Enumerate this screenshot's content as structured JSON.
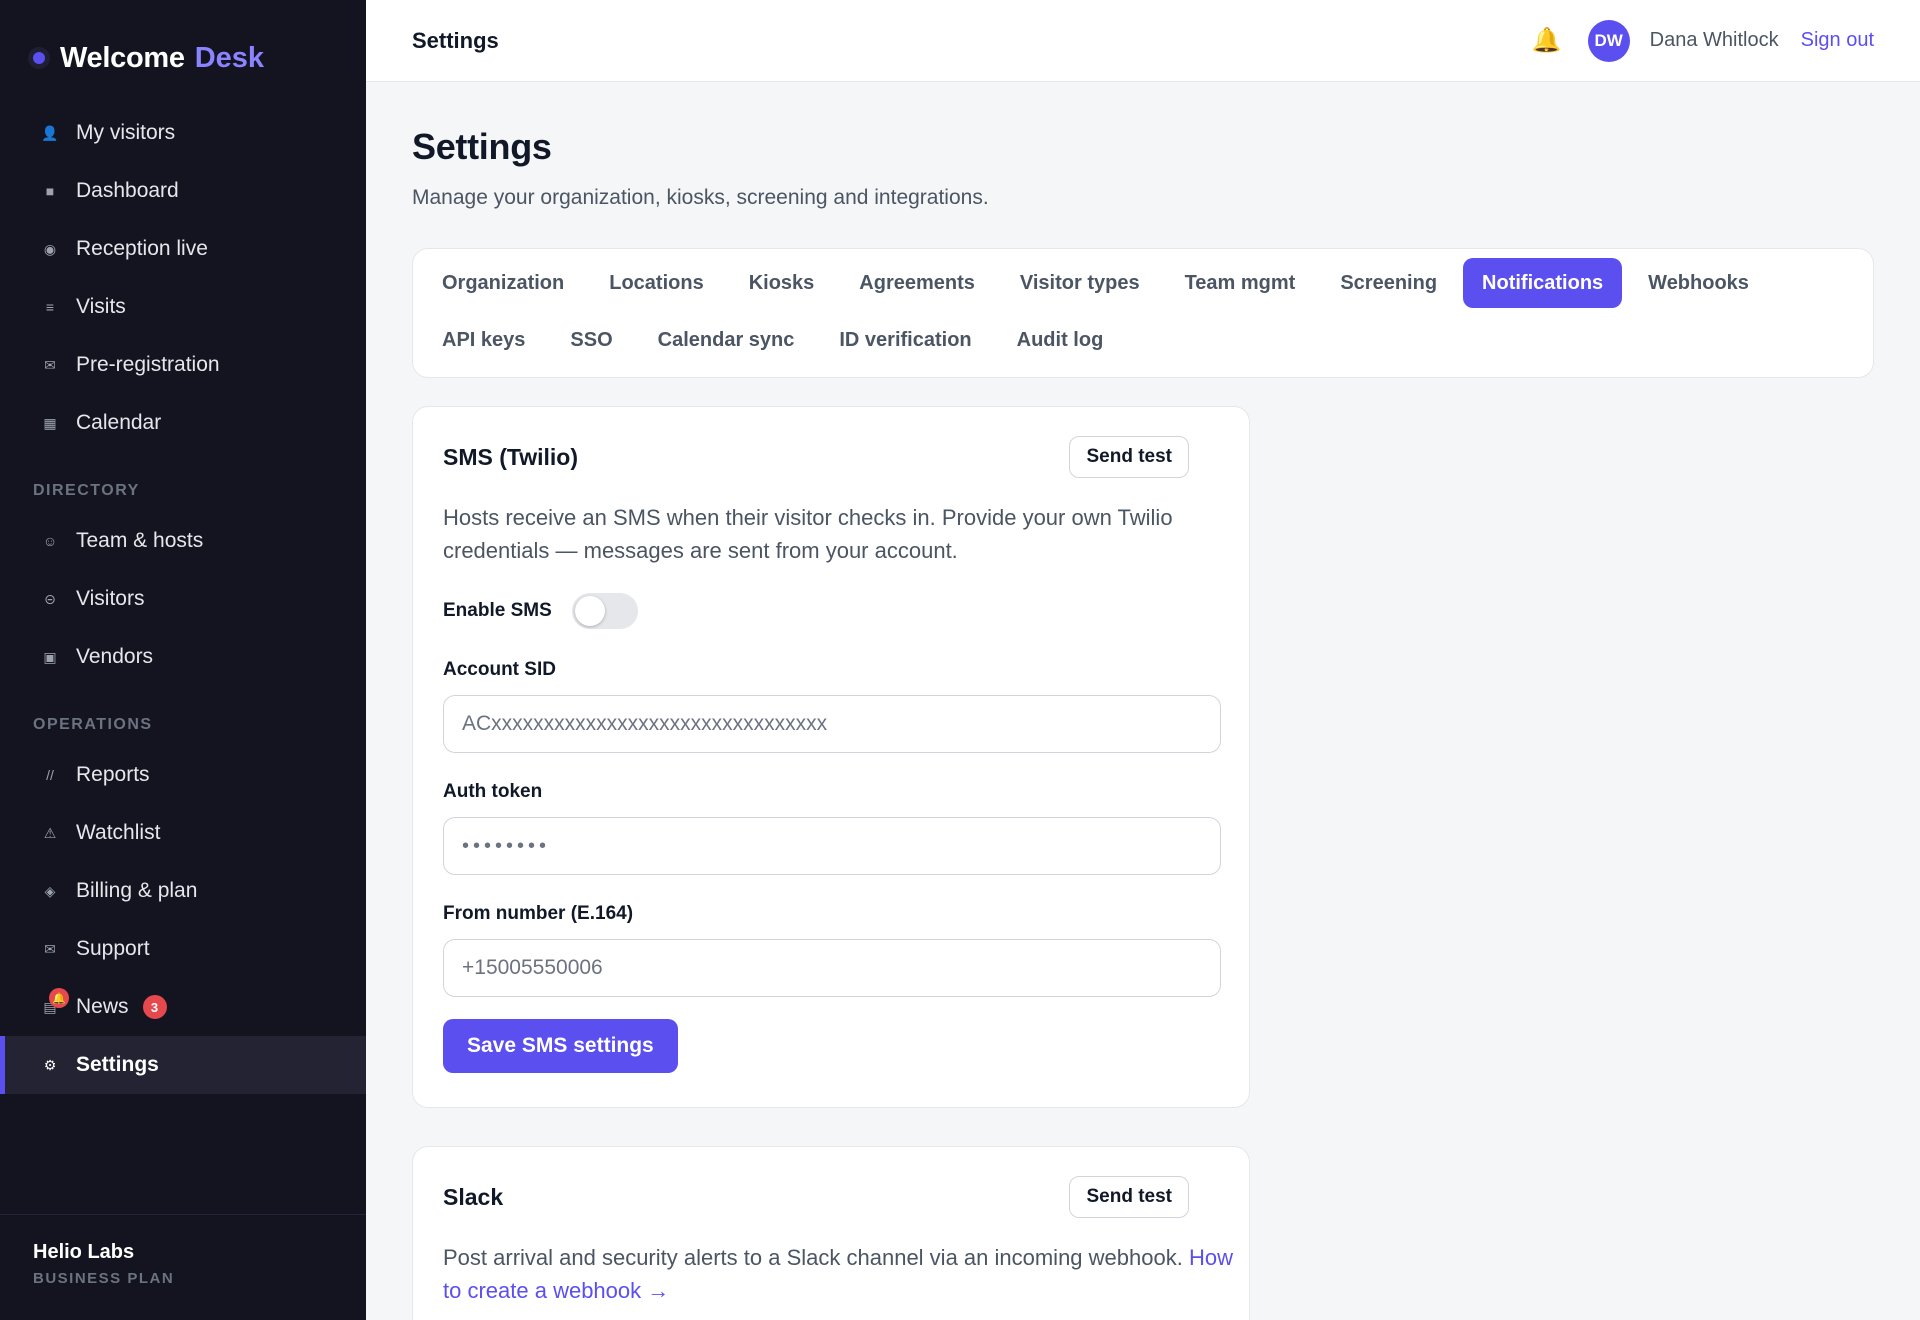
{
  "brand": {
    "name": "Welcome",
    "accent": "Desk"
  },
  "sidebar": {
    "items_top": [
      {
        "icon": "user-icon",
        "glyph": "👤",
        "label": "My visitors"
      },
      {
        "icon": "square-icon",
        "glyph": "■",
        "label": "Dashboard"
      },
      {
        "icon": "radio-icon",
        "glyph": "◉",
        "label": "Reception live"
      },
      {
        "icon": "list-icon",
        "glyph": "≡",
        "label": "Visits"
      },
      {
        "icon": "mail-icon",
        "glyph": "✉",
        "label": "Pre-registration"
      },
      {
        "icon": "grid-icon",
        "glyph": "▦",
        "label": "Calendar"
      }
    ],
    "section_directory": "DIRECTORY",
    "items_directory": [
      {
        "icon": "smile-icon",
        "glyph": "☺",
        "label": "Team & hosts"
      },
      {
        "icon": "minus-circle-icon",
        "glyph": "⊝",
        "label": "Visitors"
      },
      {
        "icon": "box-icon",
        "glyph": "▣",
        "label": "Vendors"
      }
    ],
    "section_operations": "OPERATIONS",
    "items_operations": [
      {
        "icon": "slash-icon",
        "glyph": "//",
        "label": "Reports"
      },
      {
        "icon": "warning-icon",
        "glyph": "⚠",
        "label": "Watchlist"
      },
      {
        "icon": "diamond-icon",
        "glyph": "◈",
        "label": "Billing & plan"
      },
      {
        "icon": "mail-icon",
        "glyph": "✉",
        "label": "Support"
      }
    ],
    "news": {
      "label": "News",
      "badge": "3",
      "glyph": "▤"
    },
    "settings": {
      "label": "Settings",
      "glyph": "⚙"
    },
    "footer": {
      "org": "Helio Labs",
      "plan": "BUSINESS PLAN"
    }
  },
  "topbar": {
    "title": "Settings",
    "user_initials": "DW",
    "user_name": "Dana Whitlock",
    "signout": "Sign out"
  },
  "page": {
    "title": "Settings",
    "subtitle": "Manage your organization, kiosks, screening and integrations."
  },
  "tabs": [
    "Organization",
    "Locations",
    "Kiosks",
    "Agreements",
    "Visitor types",
    "Team mgmt",
    "Screening",
    "Notifications",
    "Webhooks",
    "API keys",
    "SSO",
    "Calendar sync",
    "ID verification",
    "Audit log"
  ],
  "active_tab": "Notifications",
  "sms": {
    "title": "SMS (Twilio)",
    "send_test": "Send test",
    "description": "Hosts receive an SMS when their visitor checks in. Provide your own Twilio credentials — messages are sent from your account.",
    "enable_label": "Enable SMS",
    "enabled": false,
    "sid_label": "Account SID",
    "sid_placeholder": "ACxxxxxxxxxxxxxxxxxxxxxxxxxxxxxxxx",
    "token_label": "Auth token",
    "token_value": "••••••••",
    "from_label": "From number (E.164)",
    "from_placeholder": "+15005550006",
    "save": "Save SMS settings"
  },
  "slack": {
    "title": "Slack",
    "send_test": "Send test",
    "description": "Post arrival and security alerts to a Slack channel via an incoming webhook.",
    "link": "How to create a webhook →"
  },
  "colors": {
    "accent": "#5b4ff0",
    "sidebar": "#141420",
    "badge": "#e5484d",
    "bell": "#f59e0b"
  }
}
